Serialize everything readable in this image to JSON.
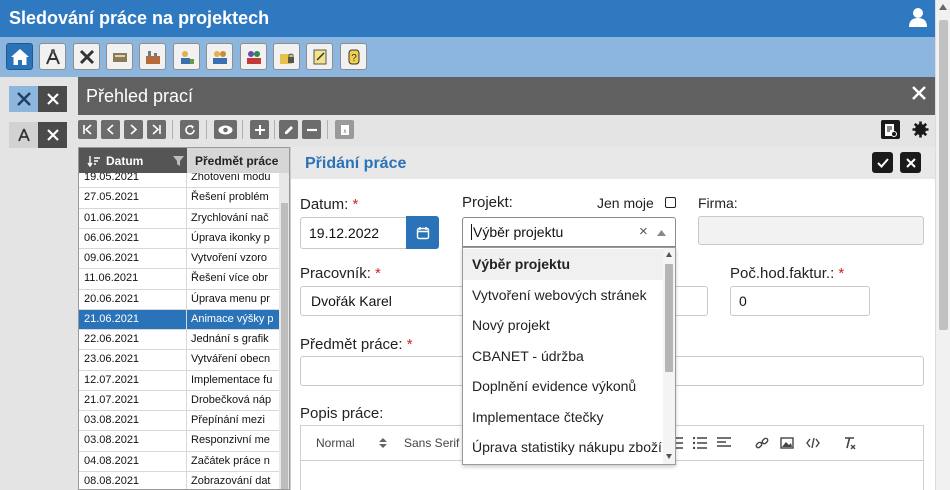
{
  "app": {
    "title": "Sledování práce na projektech"
  },
  "colors": {
    "primary": "#2e79c0",
    "selected": "#2b73b8",
    "required": "#c62828",
    "header_dark": "#606060"
  },
  "module_toolbar": {
    "icons": [
      "home-icon",
      "compass-icon",
      "tools-icon",
      "server-icon",
      "factory-icon",
      "worker-icon",
      "team-icon",
      "lock-folder-icon",
      "note-icon",
      "key-icon"
    ]
  },
  "left_tabs": [
    {
      "icon": "tools-icon"
    },
    {
      "icon": "compass-icon"
    }
  ],
  "panel": {
    "title": "Přehled prací"
  },
  "grid": {
    "columns": [
      "Datum",
      "Předmět práce"
    ],
    "rows": [
      {
        "date": "19.05.2021",
        "subject": "Zhotovení modu"
      },
      {
        "date": "27.05.2021",
        "subject": "Řešení problém"
      },
      {
        "date": "01.06.2021",
        "subject": "Zrychlování nač"
      },
      {
        "date": "06.06.2021",
        "subject": "Úprava ikonky p"
      },
      {
        "date": "09.06.2021",
        "subject": "Vytvoření vzoro"
      },
      {
        "date": "11.06.2021",
        "subject": "Řešení více obr"
      },
      {
        "date": "20.06.2021",
        "subject": "Úprava menu pr"
      },
      {
        "date": "21.06.2021",
        "subject": "Animace výšky p"
      },
      {
        "date": "22.06.2021",
        "subject": "Jednání s grafik"
      },
      {
        "date": "23.06.2021",
        "subject": "Vytváření obecn"
      },
      {
        "date": "12.07.2021",
        "subject": "Implementace fu"
      },
      {
        "date": "21.07.2021",
        "subject": "Drobečková náp"
      },
      {
        "date": "03.08.2021",
        "subject": "Přepínání mezi"
      },
      {
        "date": "03.08.2021",
        "subject": "Responzivní me"
      },
      {
        "date": "04.08.2021",
        "subject": "Začátek práce n"
      },
      {
        "date": "08.08.2021",
        "subject": "Zobrazování dat"
      }
    ],
    "selected_index": 7
  },
  "form": {
    "title": "Přidání práce",
    "date_label": "Datum:",
    "date_value": "19.12.2022",
    "project_label": "Projekt:",
    "only_mine_label": "Jen moje",
    "firm_label": "Firma:",
    "firm_value": "",
    "project_value": "Výběr projektu",
    "clear_symbol": "×",
    "worker_label": "Pracovník:",
    "worker_value": "Dvořák Karel",
    "hours_label": "Poč.hod.faktur.:",
    "hours_value": "0",
    "subject_label": "Předmět práce:",
    "subject_value": "",
    "description_label": "Popis práce:",
    "required_mark": "*"
  },
  "project_dropdown": {
    "options": [
      "Výběr projektu",
      "Vytvoření webových stránek",
      "Nový projekt",
      "CBANET - údržba",
      "Doplnění evidence výkonů",
      "Implementace čtečky",
      "Úprava statistiky nákupu zboží"
    ],
    "highlighted_index": 0
  },
  "editor_toolbar": {
    "format_label": "Normal",
    "font_label": "Sans Serif"
  }
}
